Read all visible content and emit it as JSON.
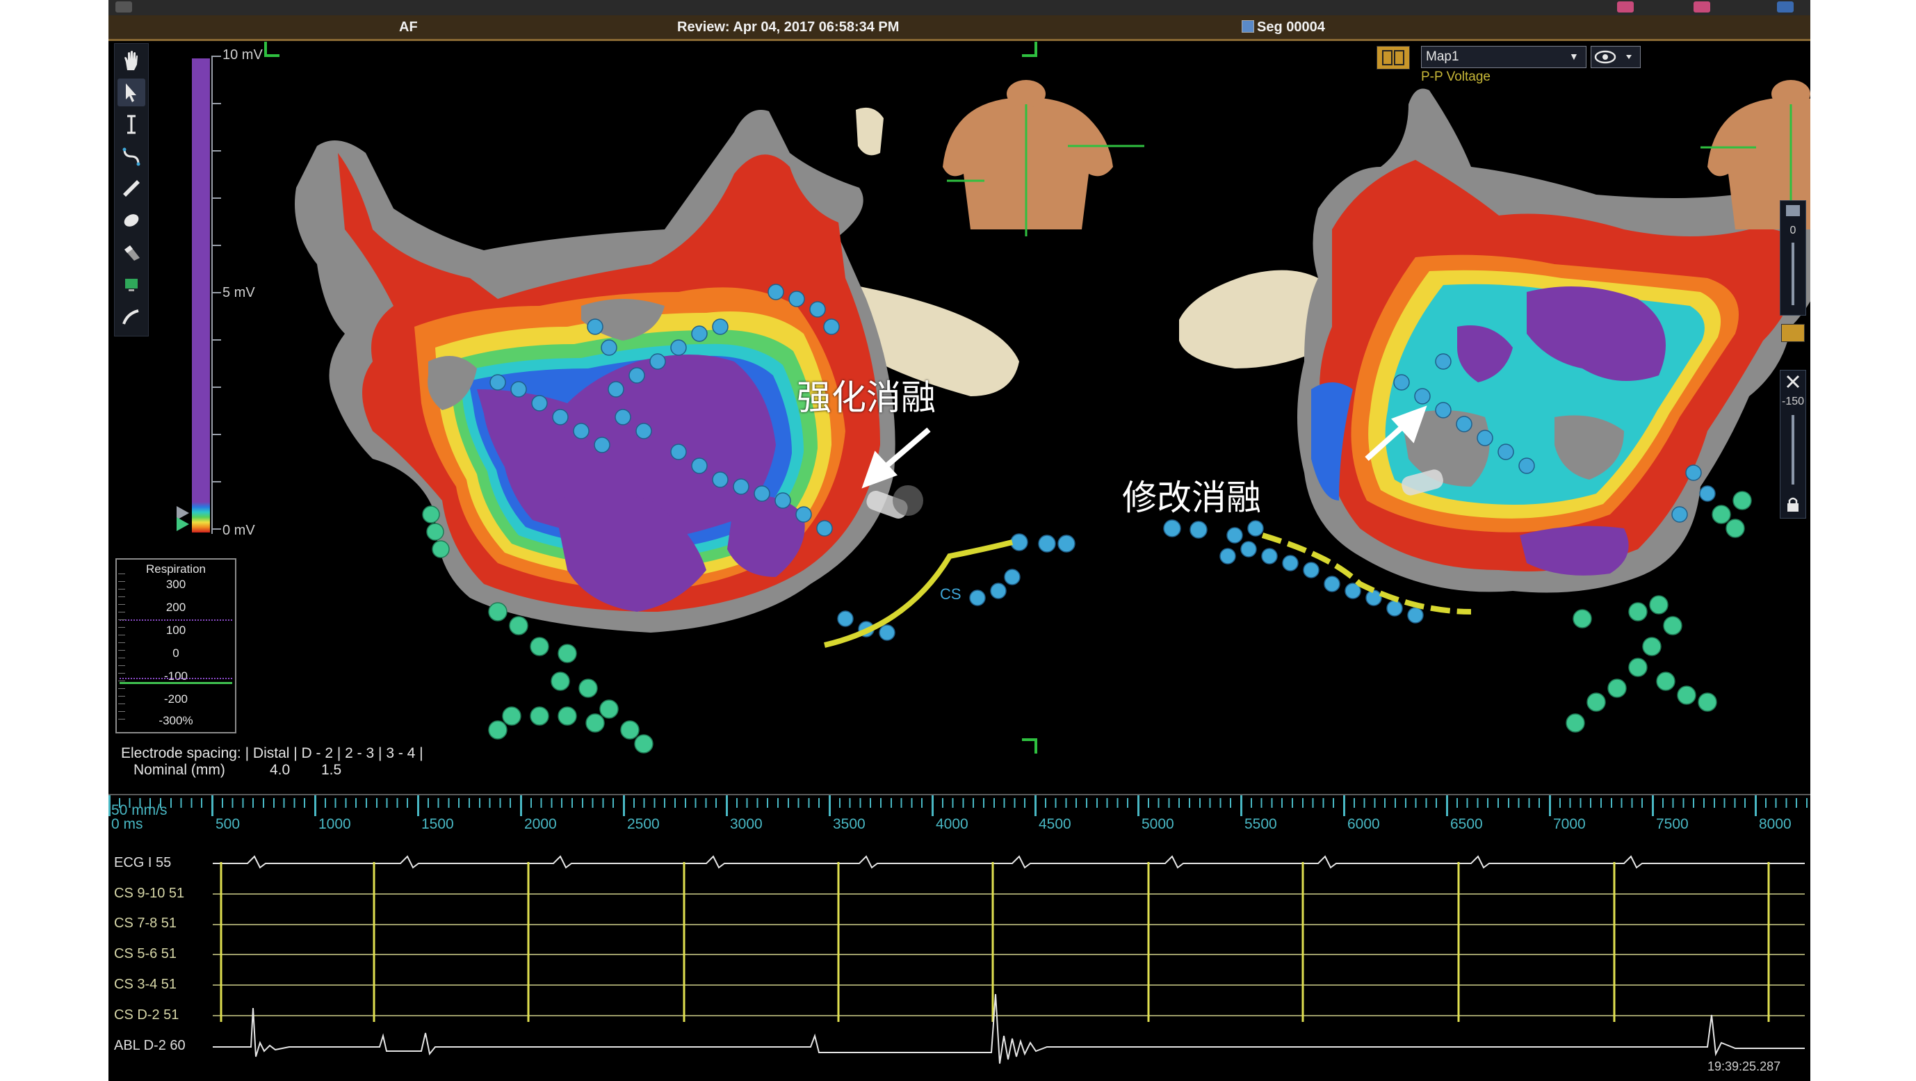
{
  "header": {
    "left": "AF",
    "center": "Review: Apr 04, 2017 06:58:34 PM",
    "right": "Seg 00004"
  },
  "voltage_scale": {
    "top": "10 mV",
    "mid": "5 mV",
    "bottom": "0 mV"
  },
  "respiration": {
    "title": "Respiration",
    "values": [
      "300",
      "200",
      "100",
      "0",
      "-100",
      "-200",
      "-300%"
    ]
  },
  "electrode": {
    "line1_label": "Electrode spacing: |",
    "line1_cols": "Distal | D - 2 | 2 - 3 | 3 - 4 |",
    "line2_label": "Nominal (mm)",
    "line2_v1": "4.0",
    "line2_v2": "1.5"
  },
  "annotations": {
    "left": "强化消融",
    "right": "修改消融",
    "cs": "CS"
  },
  "map": {
    "select_value": "Map1",
    "type_label": "P-P Voltage"
  },
  "side_slider": {
    "top_value": "0",
    "mid_value": "-150"
  },
  "timeline": {
    "speed": "50 mm/s",
    "zero": "0 ms",
    "ticks": [
      "500",
      "1000",
      "1500",
      "2000",
      "2500",
      "3000",
      "3500",
      "4000",
      "4500",
      "5000",
      "5500",
      "6000",
      "6500",
      "7000",
      "7500",
      "8000"
    ]
  },
  "channels": [
    {
      "label": "ECG I 55"
    },
    {
      "label": "CS  9-10 51"
    },
    {
      "label": "CS  7-8 51"
    },
    {
      "label": "CS  5-6 51"
    },
    {
      "label": "CS  3-4 51"
    },
    {
      "label": "CS  D-2 51"
    },
    {
      "label": "ABL  D-2 60"
    }
  ],
  "timestamp": "19:39:25.287",
  "colors": {
    "header_bg": "#3a2c18",
    "scale_bar": "#7a3fb0",
    "tick_cyan": "#49b8c4",
    "trace_yellow": "#d8d86a",
    "map_purple": "#7a3aa8",
    "map_gray": "#8a8a8a",
    "point_blue": "#3fa7d8",
    "point_green": "#3fc890"
  },
  "icons": [
    "hand-icon",
    "pointer-icon",
    "ibeam-icon",
    "curve-icon",
    "ruler-icon",
    "ellipse-icon",
    "eraser-icon",
    "monitor-icon",
    "catheter-icon",
    "eye-icon",
    "split-view-icon",
    "lock-icon",
    "scissors-icon"
  ]
}
